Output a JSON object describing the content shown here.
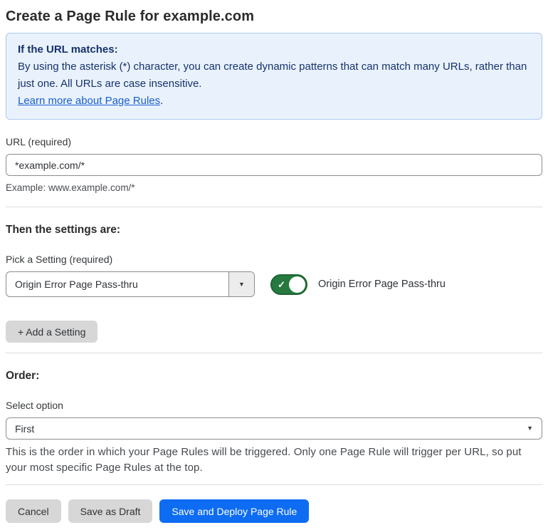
{
  "page": {
    "title": "Create a Page Rule for example.com"
  },
  "info_box": {
    "heading": "If the URL matches:",
    "body": "By using the asterisk (*) character, you can create dynamic patterns that can match many URLs, rather than just one. All URLs are case insensitive.",
    "link_label": "Learn more about Page Rules",
    "link_suffix": "."
  },
  "url_field": {
    "label": "URL (required)",
    "value": "*example.com/*",
    "helper": "Example: www.example.com/*"
  },
  "settings_section": {
    "heading": "Then the settings are:",
    "picker_label": "Pick a Setting (required)",
    "picker_value": "Origin Error Page Pass-thru",
    "toggle_state": "on",
    "toggle_check_glyph": "✓",
    "toggle_label": "Origin Error Page Pass-thru",
    "add_button_label": "+ Add a Setting"
  },
  "order_section": {
    "heading": "Order:",
    "select_label": "Select option",
    "select_value": "First",
    "caret_glyph": "▼",
    "helper": "This is the order in which your Page Rules will be triggered. Only one Page Rule will trigger per URL, so put your most specific Page Rules at the top."
  },
  "footer": {
    "cancel_label": "Cancel",
    "save_draft_label": "Save as Draft",
    "save_deploy_label": "Save and Deploy Page Rule"
  },
  "colors": {
    "info_bg": "#e9f2fc",
    "info_border": "#abc9ee",
    "info_text": "#16316b",
    "link_blue": "#1a5ecd",
    "toggle_green": "#27793f",
    "toggle_green_border": "#1d6531",
    "primary_blue": "#0d6cf2",
    "button_gray": "#d7d7d7"
  }
}
